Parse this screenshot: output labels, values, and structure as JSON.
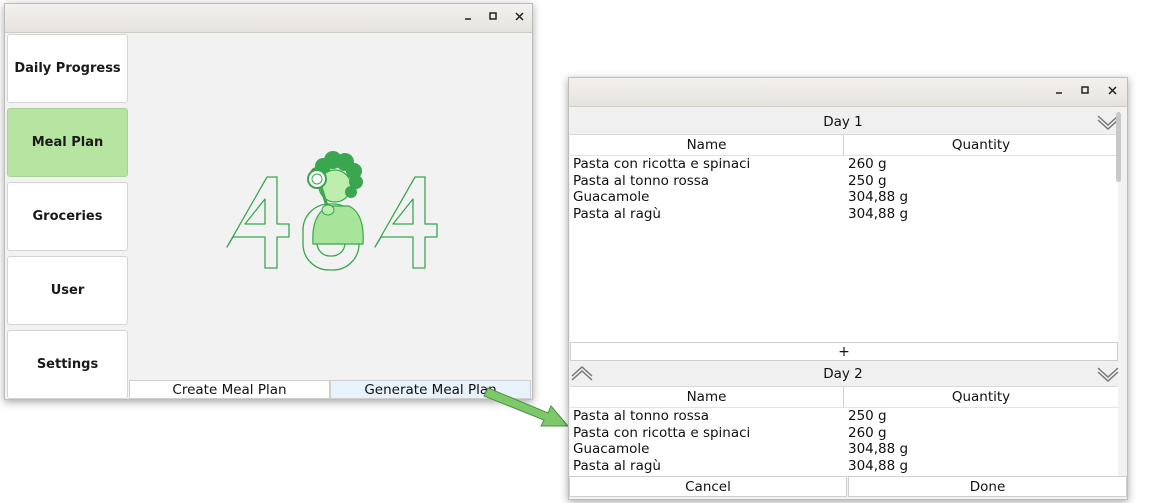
{
  "main_window": {
    "sidebar": [
      {
        "label": "Daily Progress",
        "active": false
      },
      {
        "label": "Meal Plan",
        "active": true
      },
      {
        "label": "Groceries",
        "active": false
      },
      {
        "label": "User",
        "active": false
      },
      {
        "label": "Settings",
        "active": false
      }
    ],
    "create_button": "Create Meal Plan",
    "generate_button": "Generate Meal Plan",
    "illustration": "404-illustration"
  },
  "dialog": {
    "columns": {
      "name": "Name",
      "quantity": "Quantity"
    },
    "days": [
      {
        "title": "Day 1",
        "rows": [
          {
            "name": "Pasta con ricotta e spinaci",
            "qty": "260 g"
          },
          {
            "name": "Pasta al tonno rossa",
            "qty": "250 g"
          },
          {
            "name": "Guacamole",
            "qty": "304,88 g"
          },
          {
            "name": "Pasta al ragù",
            "qty": "304,88 g"
          }
        ],
        "add_label": "+"
      },
      {
        "title": "Day 2",
        "rows": [
          {
            "name": "Pasta al tonno rossa",
            "qty": "250 g"
          },
          {
            "name": "Pasta con ricotta e spinaci",
            "qty": "260 g"
          },
          {
            "name": "Guacamole",
            "qty": "304,88 g"
          },
          {
            "name": "Pasta al ragù",
            "qty": "304,88 g"
          }
        ]
      }
    ],
    "cancel_button": "Cancel",
    "done_button": "Done"
  },
  "colors": {
    "accent": "#b6e5a2",
    "arrow": "#7dc96a",
    "illustration_green": "#3aa64f"
  }
}
